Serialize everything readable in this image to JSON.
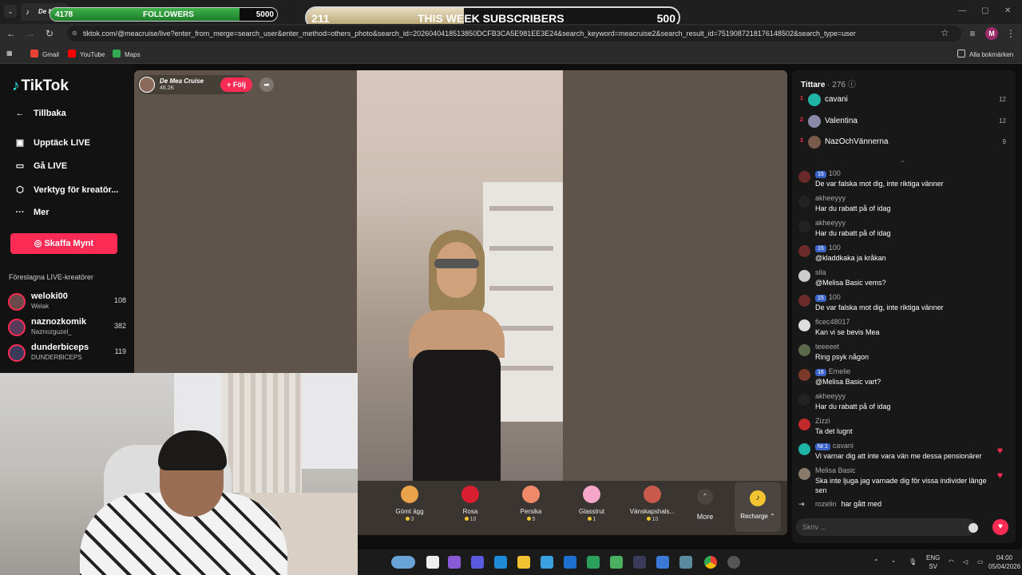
{
  "browser": {
    "tab_title": "De M",
    "url": "tiktok.com/@meacruise/live?enter_from_merge=search_user&enter_method=others_photo&search_id=2026040418513850DCFB3CA5E981EE3E24&search_keyword=meacruise2&search_result_id=7519087218176148502&search_type=user",
    "bookmarks": [
      "Gmail",
      "YouTube",
      "Maps"
    ],
    "all_bookmarks": "Alla bokmärken",
    "profile_letter": "M"
  },
  "overlays": {
    "followers": {
      "current": "4178",
      "label": "FOLLOWERS",
      "goal": "5000",
      "progress": 0.8356
    },
    "subscribers": {
      "current": "211",
      "label": "THIS WEEK SUBSCRIBERS",
      "goal": "500",
      "progress": 0.422
    }
  },
  "tiktok": {
    "logo": "TikTok",
    "back": "Tillbaka",
    "nav": [
      "Upptäck LIVE",
      "Gå LIVE",
      "Verktyg för kreatör...",
      "Mer"
    ],
    "coins_button": "Skaffa Mynt",
    "suggested_title": "Föreslagna LIVE-kreatörer",
    "creators": [
      {
        "name": "weloki00",
        "sub": "Welak",
        "count": "108"
      },
      {
        "name": "naznozkomik",
        "sub": "Naznozguzel_",
        "count": "382"
      },
      {
        "name": "dunderbiceps",
        "sub": "DUNDERBICEPS",
        "count": "119"
      }
    ]
  },
  "live": {
    "host_name": "De Mea Cruise",
    "host_likes": "46.2K",
    "follow": "+ Följ",
    "gifts": [
      {
        "name": "Gömt ägg",
        "price": "3",
        "color": "#e9a34a"
      },
      {
        "name": "Rosa",
        "price": "10",
        "color": "#d81e2f"
      },
      {
        "name": "Persika",
        "price": "5",
        "color": "#f0886a"
      },
      {
        "name": "Glasstrut",
        "price": "1",
        "color": "#f6a6c8"
      },
      {
        "name": "Vänskapshals...",
        "price": "10",
        "color": "#c75a4a"
      }
    ],
    "more": "More",
    "recharge": "Recharge"
  },
  "chat": {
    "viewers_label": "Tittare",
    "viewers_count": "276",
    "top_viewers": [
      {
        "rank": "1",
        "name": "cavani",
        "score": "12",
        "color": "#1fb5a6"
      },
      {
        "rank": "2",
        "name": "Valentina",
        "score": "12",
        "color": "#8a8aa8"
      },
      {
        "rank": "3",
        "name": "NazOchVännerna",
        "score": "9",
        "color": "#7a5a4a"
      }
    ],
    "messages": [
      {
        "user": "100",
        "badge": "15",
        "text": "De var falska mot dig, inte riktiga vänner",
        "color": "#6a2a2a"
      },
      {
        "user": "akheeyyy",
        "text": "Har du rabatt på of idag",
        "color": "#222"
      },
      {
        "user": "akheeyyy",
        "text": "Har du rabatt på of idag",
        "color": "#222"
      },
      {
        "user": "100",
        "badge": "15",
        "text": "@kladdkaka ja kråkan",
        "color": "#6a2a2a"
      },
      {
        "user": "sila",
        "text": "@Melisa Basic vems?",
        "color": "#ccc"
      },
      {
        "user": "100",
        "badge": "15",
        "text": "De var falska mot dig, inte riktiga vänner",
        "color": "#6a2a2a"
      },
      {
        "user": "ficec48017",
        "text": "Kan vi se bevis Mea",
        "color": "#ddd"
      },
      {
        "user": "teeeeet",
        "text": "Ring psyk någon",
        "color": "#5a6a4a"
      },
      {
        "user": "Emelie",
        "badge": "16",
        "text": "@Melisa Basic vart?",
        "color": "#7a3a2a"
      },
      {
        "user": "akheeyyy",
        "text": "Har du rabatt på of idag",
        "color": "#222"
      },
      {
        "user": "Zizzi",
        "text": "Ta det lugnt",
        "color": "#c02a2a"
      },
      {
        "user": "cavani",
        "badge": "Nr.1",
        "text": "Vi varnar dig att inte vara vän me dessa pensionärer",
        "color": "#1fb5a6",
        "heart": true
      },
      {
        "user": "Melisa Basic",
        "text": "Ska inte ljuga jag varnade dig för vissa individer länge sen",
        "color": "#8a7a6a",
        "heart": true
      }
    ],
    "joined_user": "rozelin",
    "joined_text": "har gått med",
    "input_placeholder": "Skriv ..."
  },
  "taskbar": {
    "lang": "ENG",
    "region": "SV",
    "time": "04:00",
    "date": "05/04/2026"
  }
}
